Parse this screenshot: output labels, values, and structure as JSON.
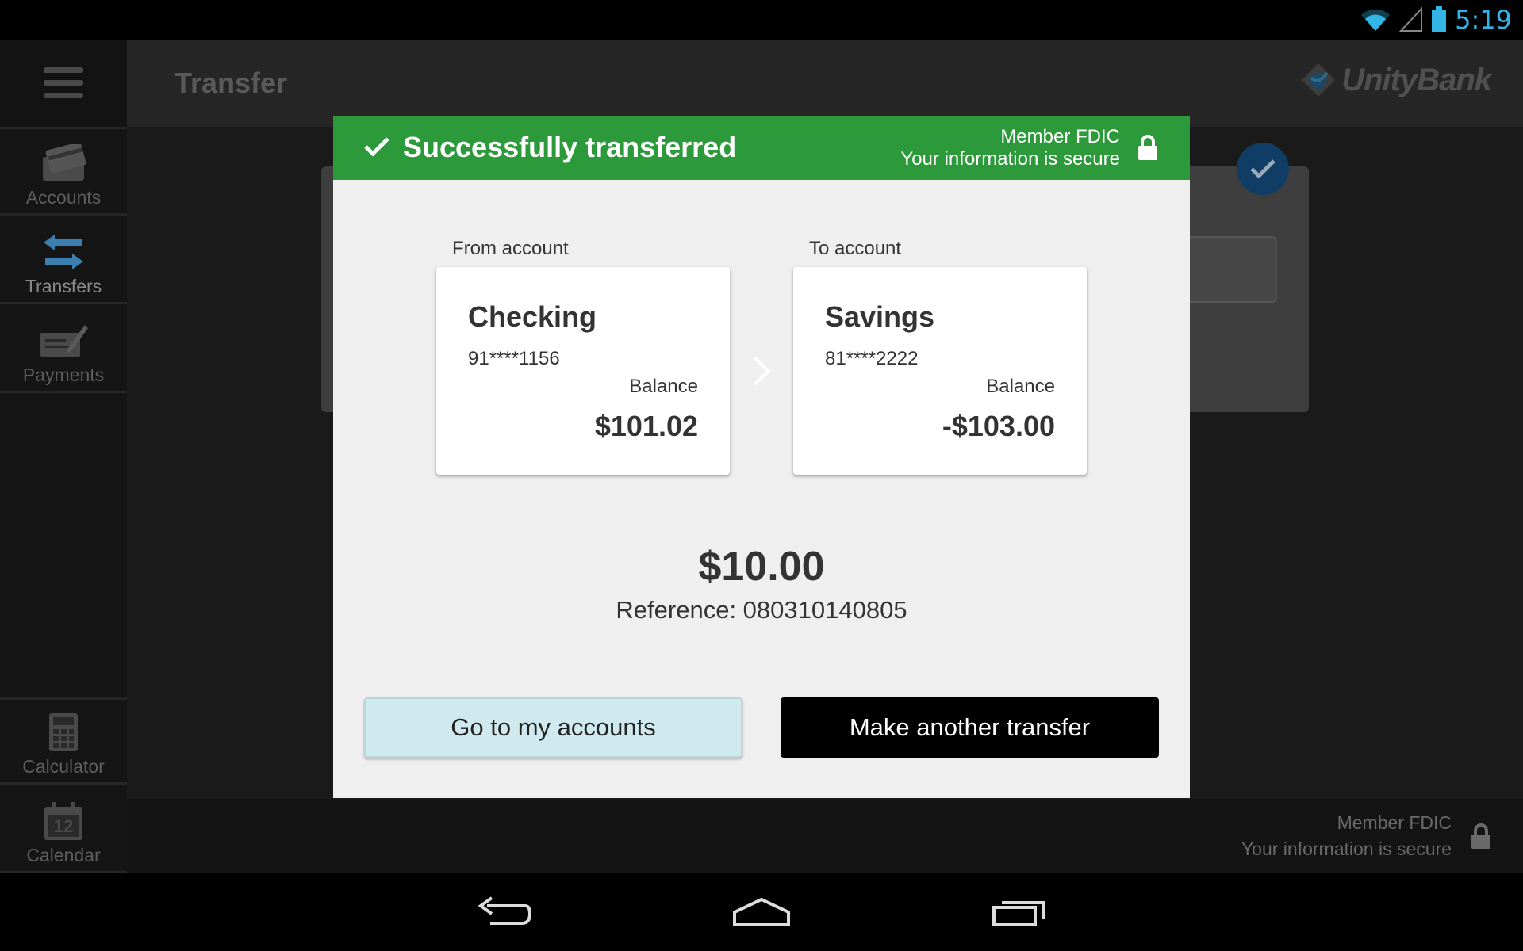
{
  "status_bar": {
    "time": "5:19"
  },
  "app": {
    "page_title": "Transfer",
    "brand": "UnityBank",
    "sidebar": {
      "items": [
        {
          "label": "Accounts",
          "icon": "credit-card-icon"
        },
        {
          "label": "Transfers",
          "icon": "transfer-arrows-icon"
        },
        {
          "label": "Payments",
          "icon": "check-pen-icon"
        },
        {
          "label": "Calculator",
          "icon": "calculator-icon"
        },
        {
          "label": "Calendar",
          "icon": "calendar-icon",
          "day": "12"
        }
      ]
    },
    "footer": {
      "line1": "Member FDIC",
      "line2": "Your information is secure"
    }
  },
  "dialog": {
    "title": "Successfully transferred",
    "secure_line1": "Member FDIC",
    "secure_line2": "Your information is secure",
    "from": {
      "label": "From account",
      "name": "Checking",
      "number": "91****1156",
      "balance_label": "Balance",
      "balance": "$101.02"
    },
    "to": {
      "label": "To account",
      "name": "Savings",
      "number": "81****2222",
      "balance_label": "Balance",
      "balance": "-$103.00"
    },
    "amount": "$10.00",
    "reference": "Reference: 080310140805",
    "buttons": {
      "accounts": "Go to my accounts",
      "another": "Make another transfer"
    }
  },
  "colors": {
    "success_green": "#2c9a3b",
    "status_blue": "#33b5e5",
    "button_light": "#cfe9ee"
  }
}
